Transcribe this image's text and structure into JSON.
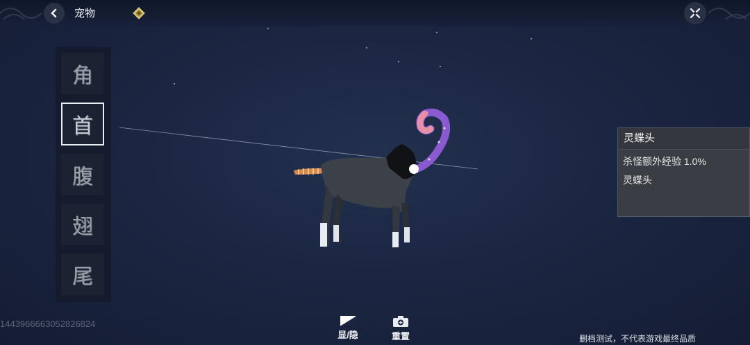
{
  "header": {
    "title": "宠物"
  },
  "sidebar": {
    "tabs": [
      {
        "label": "角",
        "active": false
      },
      {
        "label": "首",
        "active": true
      },
      {
        "label": "腹",
        "active": false
      },
      {
        "label": "翅",
        "active": false
      },
      {
        "label": "尾",
        "active": false
      }
    ]
  },
  "info_panel": {
    "title": "灵蝶头",
    "effect": "杀怪额外经验 1.0%",
    "name": "灵蝶头"
  },
  "toolbar": {
    "toggle_label": "显/隐",
    "reset_label": "重置"
  },
  "footer": {
    "uid": "1443966663052826824",
    "notice": "删档测试，不代表游戏最终品质"
  },
  "colors": {
    "background": "#1b2642",
    "panel": "#3a3d44",
    "tentacle": "#8a5bd0"
  }
}
